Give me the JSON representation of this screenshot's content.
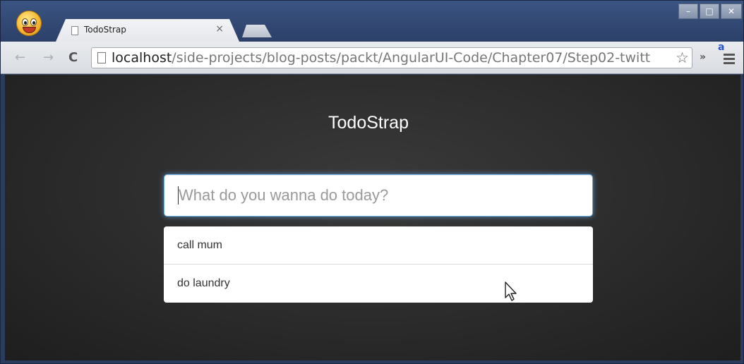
{
  "browser": {
    "tab": {
      "title": "TodoStrap",
      "close_label": "×"
    },
    "window_controls": {
      "minimize": "–",
      "maximize": "□",
      "close": "✕"
    },
    "toolbar": {
      "back_icon": "←",
      "forward_icon": "→",
      "reload_icon": "C",
      "url_host": "localhost",
      "url_path": "/side-projects/blog-posts/packt/AngularUI-Code/Chapter07/Step02-twitt",
      "star_icon": "☆",
      "extensions_chevron": "»",
      "extension_badge": "a"
    }
  },
  "app": {
    "title": "TodoStrap",
    "input": {
      "placeholder": "What do you wanna do today?",
      "value": ""
    },
    "todos": [
      {
        "text": "call mum"
      },
      {
        "text": "do laundry"
      }
    ]
  }
}
